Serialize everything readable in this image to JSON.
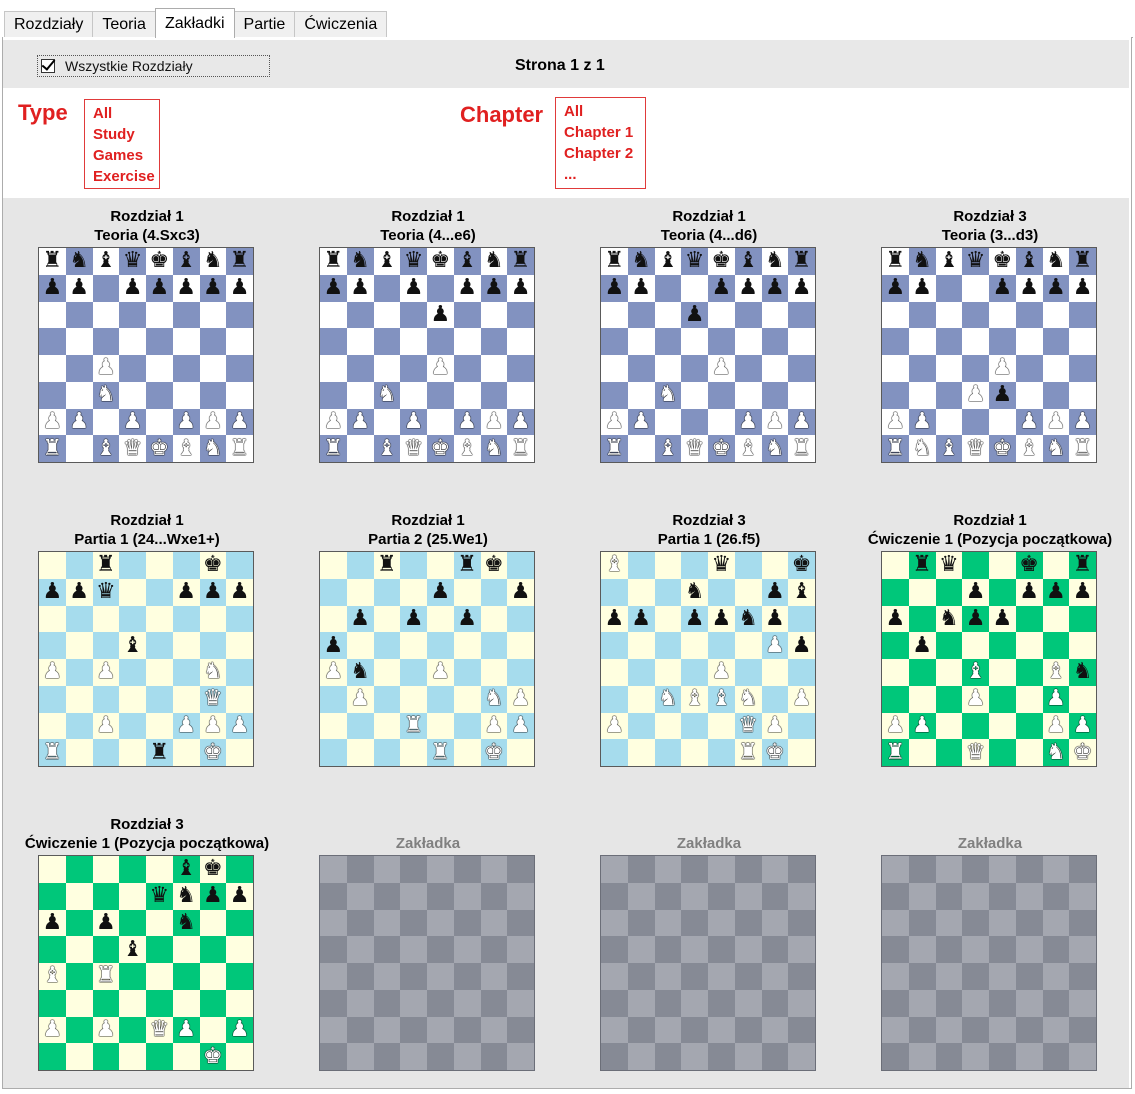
{
  "tabs": [
    "Rozdziały",
    "Teoria",
    "Zakładki",
    "Partie",
    "Ćwiczenia"
  ],
  "active_tab": 2,
  "toolbar": {
    "all_chapters_label": "Wszystkie Rozdziały",
    "all_chapters_checked": true,
    "page_info": "Strona 1 z 1"
  },
  "filters": {
    "type_title": "Type",
    "type_options": [
      "All",
      "Study",
      "Games",
      "Exercise"
    ],
    "chapter_title": "Chapter",
    "chapter_options": [
      "All",
      "Chapter 1",
      "Chapter 2",
      "..."
    ]
  },
  "colors": {
    "theory": {
      "light": "#ffffff",
      "dark": "#8292c0"
    },
    "games": {
      "light": "#ffffe0",
      "dark": "#a6dced"
    },
    "exercise": {
      "light": "#ffffe0",
      "dark": "#00c77a"
    },
    "empty": {
      "light": "#a4a7b0",
      "dark": "#868a95"
    },
    "accent_red": "#e02020"
  },
  "cards": [
    {
      "line1": "Rozdział 1",
      "line2": "Teoria (4.Sxc3)",
      "theme": "theory",
      "board": [
        "rnbqkbnr",
        "pp.ppppp",
        "........",
        "........",
        "..P.....",
        "..N.....",
        "PP.P.PPP",
        "R.BQKBNR"
      ]
    },
    {
      "line1": "Rozdział 1",
      "line2": "Teoria (4...e6)",
      "theme": "theory",
      "board": [
        "rnbqkbnr",
        "pp.p.ppp",
        "....p...",
        "........",
        "....P...",
        "..N.....",
        "PP.P.PPP",
        "R.BQKBNR"
      ]
    },
    {
      "line1": "Rozdział 1",
      "line2": "Teoria (4...d6)",
      "theme": "theory",
      "board": [
        "rnbqkbnr",
        "pp..pppp",
        "...p....",
        "........",
        "....P...",
        "..N.....",
        "PP...PPP",
        "R.BQKBNR"
      ]
    },
    {
      "line1": "Rozdział 3",
      "line2": "Teoria (3...d3)",
      "theme": "theory",
      "board": [
        "rnbqkbnr",
        "pp..pppp",
        "........",
        "........",
        "....P...",
        "...Pp...",
        "PP...PPP",
        "RNBQKBNR"
      ]
    },
    {
      "line1": "Rozdział 1",
      "line2": "Partia 1 (24...Wxe1+)",
      "theme": "games",
      "board": [
        "..r...k.",
        "ppq..ppp",
        "........",
        "...b....",
        "P.P...N.",
        "......Q.",
        "..P..PPP",
        "R...r.K."
      ]
    },
    {
      "line1": "Rozdział 1",
      "line2": "Partia 2 (25.We1)",
      "theme": "games",
      "board": [
        "..r..rk.",
        "....p..p",
        ".p.p.p..",
        "p.......",
        "Pn..P...",
        ".P....NP",
        "...R..PP",
        "....R.K."
      ]
    },
    {
      "line1": "Rozdział 3",
      "line2": "Partia 1 (26.f5)",
      "theme": "games",
      "board": [
        "B...q..k",
        "...n..pb",
        "pp.ppnp.",
        "......Pp",
        "....P...",
        "..NBBN.P",
        "P....QP.",
        ".....RK."
      ]
    },
    {
      "line1": "Rozdział 1",
      "line2": "Ćwiczenie 1 (Pozycja początkowa)",
      "theme": "exercise",
      "board": [
        ".rq..k.r",
        "...p.ppp",
        "p.npp...",
        ".p......",
        "...B..Bn",
        "...P..P.",
        "PP....PP",
        "R..Q..NK"
      ]
    },
    {
      "line1": "Rozdział 3",
      "line2": "Ćwiczenie 1 (Pozycja początkowa)",
      "theme": "exercise",
      "board": [
        ".....bk.",
        "....qnpp",
        "p.p..n..",
        "...b....",
        "B.R.....",
        "........",
        "P.P.QP.P",
        "......K."
      ]
    },
    {
      "line1": "",
      "line2": "Zakładka",
      "theme": "empty",
      "board": null
    },
    {
      "line1": "",
      "line2": "Zakładka",
      "theme": "empty",
      "board": null
    },
    {
      "line1": "",
      "line2": "Zakładka",
      "theme": "empty",
      "board": null
    }
  ]
}
